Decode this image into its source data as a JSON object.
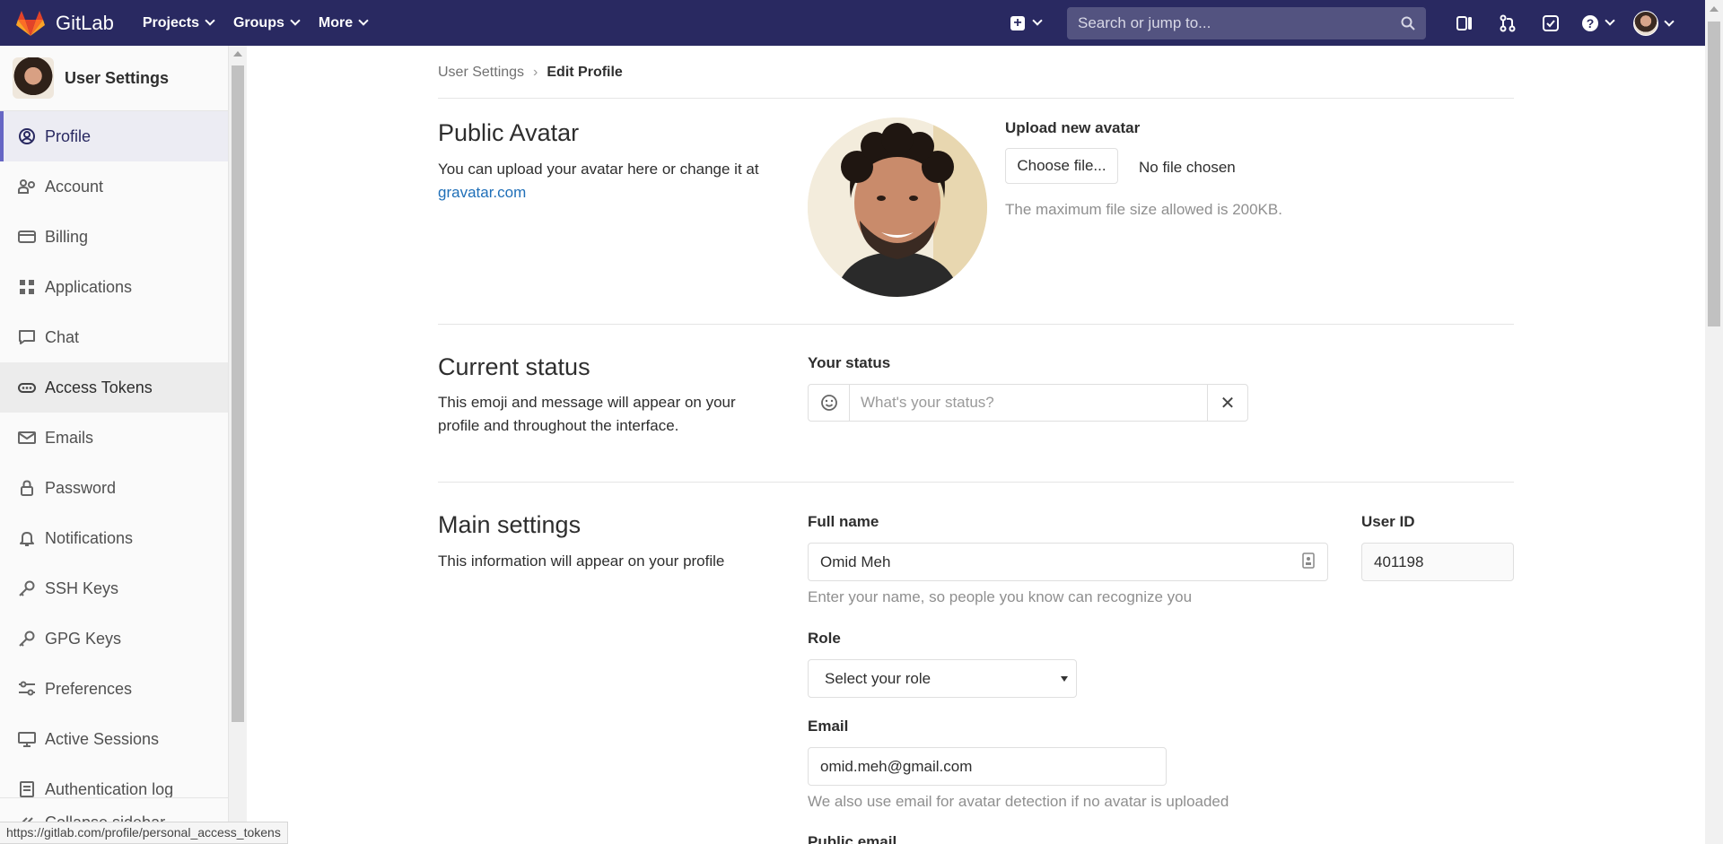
{
  "navbar": {
    "brand": "GitLab",
    "menu": [
      "Projects",
      "Groups",
      "More"
    ],
    "search_placeholder": "Search or jump to...",
    "bg_color": "#292961",
    "icons": [
      "plus-square-icon",
      "search-icon",
      "sidebar-toggle-icon",
      "merge-request-icon",
      "todo-check-icon",
      "help-icon",
      "user-avatar"
    ]
  },
  "sidebar": {
    "title": "User Settings",
    "items": [
      {
        "label": "Profile",
        "icon": "profile-icon",
        "active": true
      },
      {
        "label": "Account",
        "icon": "account-icon"
      },
      {
        "label": "Billing",
        "icon": "billing-icon"
      },
      {
        "label": "Applications",
        "icon": "applications-icon"
      },
      {
        "label": "Chat",
        "icon": "chat-icon"
      },
      {
        "label": "Access Tokens",
        "icon": "token-icon",
        "hover": true
      },
      {
        "label": "Emails",
        "icon": "mail-icon"
      },
      {
        "label": "Password",
        "icon": "lock-icon"
      },
      {
        "label": "Notifications",
        "icon": "bell-icon"
      },
      {
        "label": "SSH Keys",
        "icon": "key-icon"
      },
      {
        "label": "GPG Keys",
        "icon": "key-icon"
      },
      {
        "label": "Preferences",
        "icon": "preferences-icon"
      },
      {
        "label": "Active Sessions",
        "icon": "monitor-icon"
      },
      {
        "label": "Authentication log",
        "icon": "log-icon"
      },
      {
        "label": "Collapse sidebar",
        "icon": "collapse-icon"
      }
    ]
  },
  "breadcrumb": {
    "parent": "User Settings",
    "current": "Edit Profile"
  },
  "avatar_section": {
    "title": "Public Avatar",
    "desc": "You can upload your avatar here or change it at",
    "link": "gravatar.com",
    "upload_label": "Upload new avatar",
    "choose_button": "Choose file...",
    "no_file": "No file chosen",
    "help": "The maximum file size allowed is 200KB."
  },
  "status_section": {
    "title": "Current status",
    "desc": "This emoji and message will appear on your profile and throughout the interface.",
    "label": "Your status",
    "placeholder": "What's your status?"
  },
  "main_section": {
    "title": "Main settings",
    "desc": "This information will appear on your profile",
    "full_name_label": "Full name",
    "full_name_value": "Omid Meh",
    "full_name_help": "Enter your name, so people you know can recognize you",
    "user_id_label": "User ID",
    "user_id_value": "401198",
    "role_label": "Role",
    "role_value": "Select your role",
    "email_label": "Email",
    "email_value": "omid.meh@gmail.com",
    "email_help": "We also use email for avatar detection if no avatar is uploaded",
    "public_email_label": "Public email"
  },
  "statusbar": {
    "url": "https://gitlab.com/profile/personal_access_tokens"
  }
}
